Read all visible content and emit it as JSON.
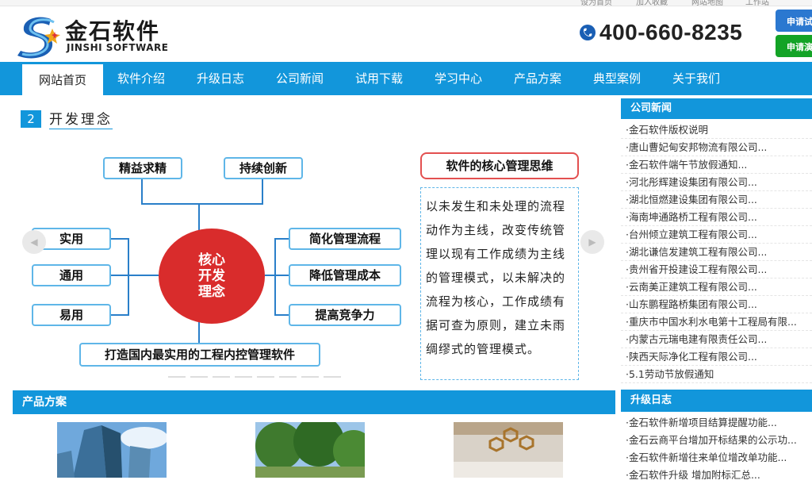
{
  "topbar": {
    "links": [
      "设为首页",
      "加入收藏",
      "网站地图",
      "工作站"
    ]
  },
  "header": {
    "logo_cn": "金石软件",
    "logo_en": "JINSHI SOFTWARE",
    "phone": "400-660-8235",
    "apply_trial": "申请试用",
    "apply_demo": "申请演示"
  },
  "nav": {
    "items": [
      "网站首页",
      "软件介绍",
      "升级日志",
      "公司新闻",
      "试用下载",
      "学习中心",
      "产品方案",
      "典型案例",
      "关于我们"
    ],
    "active": "网站首页"
  },
  "concept": {
    "number": "2",
    "title": "开发理念",
    "top_boxes": [
      "精益求精",
      "持续创新"
    ],
    "left_boxes": [
      "实用",
      "通用",
      "易用"
    ],
    "right_boxes": [
      "简化管理流程",
      "降低管理成本",
      "提高竞争力"
    ],
    "core": [
      "核心",
      "开发",
      "理念"
    ],
    "bottom_box": "打造国内最实用的工程内控管理软件",
    "thinking_title": "软件的核心管理思维",
    "thinking_text": "以未发生和未处理的流程动作为主线，改变传统管理以现有工作成绩为主线的管理模式，以未解决的流程为核心，工作成绩有据可查为原则，建立未雨绸缪式的管理模式。"
  },
  "products": {
    "title": "产品方案"
  },
  "sidebar": {
    "news_title": "公司新闻",
    "news": [
      "·金石软件版权说明",
      "·唐山曹妃甸安邦物流有限公司...",
      "·金石软件端午节放假通知...",
      "·河北彤辉建设集团有限公司...",
      "·湖北恒燃建设集团有限公司...",
      "·海南坤通路桥工程有限公司...",
      "·台州倾立建筑工程有限公司...",
      "·湖北谦信发建筑工程有限公司...",
      "·贵州省开投建设工程有限公司...",
      "·云南美正建筑工程有限公司...",
      "·山东鹏程路桥集团有限公司...",
      "·重庆市中国水利水电第十工程局有限...",
      "·内蒙古元瑞电建有限责任公司...",
      "·陕西天际净化工程有限公司...",
      "·5.1劳动节放假通知"
    ],
    "updates_title": "升级日志",
    "updates": [
      "·金石软件新增项目结算提醒功能...",
      "·金石云商平台增加开标结果的公示功...",
      "·金石软件新增往来单位增改单功能...",
      "·金石软件升级 增加附标汇总..."
    ]
  },
  "colors": {
    "brand_blue": "#1296db",
    "core_red": "#d92c2c",
    "green": "#13a326"
  }
}
